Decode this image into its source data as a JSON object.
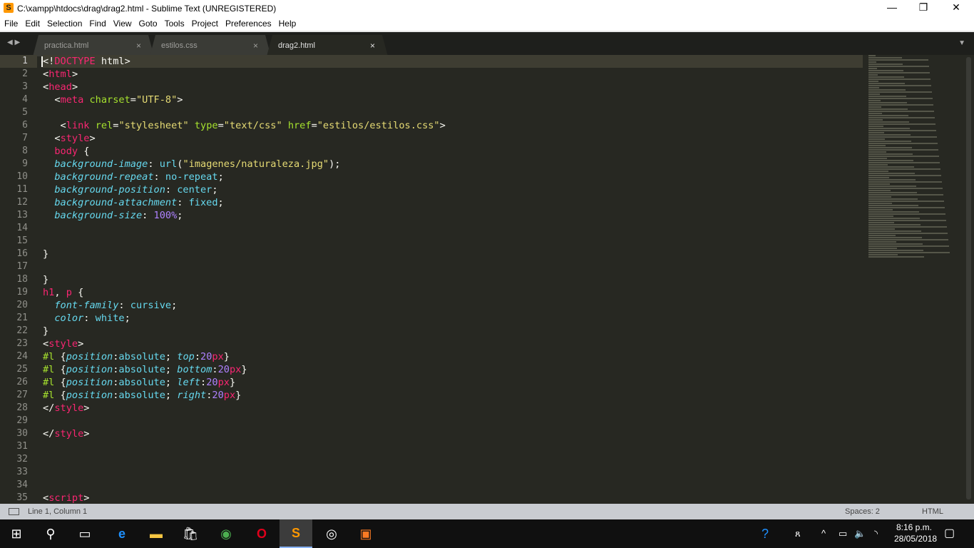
{
  "window": {
    "title": "C:\\xampp\\htdocs\\drag\\drag2.html - Sublime Text (UNREGISTERED)",
    "minimize": "—",
    "maximize": "❐",
    "close": "✕"
  },
  "menu": [
    "File",
    "Edit",
    "Selection",
    "Find",
    "View",
    "Goto",
    "Tools",
    "Project",
    "Preferences",
    "Help"
  ],
  "tabs": [
    {
      "label": "practica.html",
      "close": "×"
    },
    {
      "label": "estilos.css",
      "close": "×"
    },
    {
      "label": "drag2.html",
      "close": "×",
      "active": true
    }
  ],
  "editor": {
    "current_line": 1,
    "lines": [
      [
        [
          "<!",
          ""
        ],
        [
          "DOCTYPE",
          "k-tag"
        ],
        [
          " html>",
          ""
        ]
      ],
      [
        [
          "<",
          ""
        ],
        [
          "html",
          "k-tag"
        ],
        [
          ">",
          ""
        ]
      ],
      [
        [
          "<",
          ""
        ],
        [
          "head",
          "k-tag"
        ],
        [
          ">",
          ""
        ]
      ],
      [
        [
          "  <",
          ""
        ],
        [
          "meta",
          "k-tag"
        ],
        [
          " ",
          ""
        ],
        [
          "charset",
          "k-attr"
        ],
        [
          "=",
          ""
        ],
        [
          "\"UTF-8\"",
          "k-str"
        ],
        [
          ">",
          ""
        ]
      ],
      [
        [
          "",
          ""
        ]
      ],
      [
        [
          "   <",
          ""
        ],
        [
          "link",
          "k-tag"
        ],
        [
          " ",
          ""
        ],
        [
          "rel",
          "k-attr"
        ],
        [
          "=",
          ""
        ],
        [
          "\"stylesheet\"",
          "k-str"
        ],
        [
          " ",
          ""
        ],
        [
          "type",
          "k-attr"
        ],
        [
          "=",
          ""
        ],
        [
          "\"text/css\"",
          "k-str"
        ],
        [
          " ",
          ""
        ],
        [
          "href",
          "k-attr"
        ],
        [
          "=",
          ""
        ],
        [
          "\"estilos/estilos.css\"",
          "k-str"
        ],
        [
          ">",
          ""
        ]
      ],
      [
        [
          "  <",
          ""
        ],
        [
          "style",
          "k-tag"
        ],
        [
          ">",
          ""
        ]
      ],
      [
        [
          "  ",
          ""
        ],
        [
          "body",
          "k-tag"
        ],
        [
          " {",
          ""
        ]
      ],
      [
        [
          "  ",
          ""
        ],
        [
          "background-image",
          "k-prop"
        ],
        [
          ": ",
          ""
        ],
        [
          "url",
          "k-val"
        ],
        [
          "(",
          ""
        ],
        [
          "\"imagenes/naturaleza.jpg\"",
          "k-str"
        ],
        [
          ");",
          ""
        ]
      ],
      [
        [
          "  ",
          ""
        ],
        [
          "background-repeat",
          "k-prop"
        ],
        [
          ": ",
          ""
        ],
        [
          "no-repeat",
          "k-val"
        ],
        [
          ";",
          ""
        ]
      ],
      [
        [
          "  ",
          ""
        ],
        [
          "background-position",
          "k-prop"
        ],
        [
          ": ",
          ""
        ],
        [
          "center",
          "k-val"
        ],
        [
          ";",
          ""
        ]
      ],
      [
        [
          "  ",
          ""
        ],
        [
          "background-attachment",
          "k-prop"
        ],
        [
          ": ",
          ""
        ],
        [
          "fixed",
          "k-val"
        ],
        [
          ";",
          ""
        ]
      ],
      [
        [
          "  ",
          ""
        ],
        [
          "background-size",
          "k-prop"
        ],
        [
          ": ",
          ""
        ],
        [
          "100",
          "k-num"
        ],
        [
          "%",
          "k-num"
        ],
        [
          ";",
          ""
        ]
      ],
      [
        [
          "",
          ""
        ]
      ],
      [
        [
          "",
          ""
        ]
      ],
      [
        [
          "}",
          ""
        ]
      ],
      [
        [
          "",
          ""
        ]
      ],
      [
        [
          "}",
          ""
        ]
      ],
      [
        [
          "h1",
          "k-tag"
        ],
        [
          ", ",
          ""
        ],
        [
          "p",
          "k-tag"
        ],
        [
          " {",
          ""
        ]
      ],
      [
        [
          "  ",
          ""
        ],
        [
          "font-family",
          "k-prop"
        ],
        [
          ": ",
          ""
        ],
        [
          "cursive",
          "k-val"
        ],
        [
          ";",
          ""
        ]
      ],
      [
        [
          "  ",
          ""
        ],
        [
          "color",
          "k-prop"
        ],
        [
          ": ",
          ""
        ],
        [
          "white",
          "k-val"
        ],
        [
          ";",
          ""
        ]
      ],
      [
        [
          "}",
          ""
        ]
      ],
      [
        [
          "<",
          ""
        ],
        [
          "style",
          "k-tag"
        ],
        [
          ">",
          ""
        ]
      ],
      [
        [
          "#l",
          "k-sel"
        ],
        [
          " {",
          ""
        ],
        [
          "position",
          "k-prop"
        ],
        [
          ":",
          ""
        ],
        [
          "absolute",
          "k-val"
        ],
        [
          "; ",
          ""
        ],
        [
          "top",
          "k-prop"
        ],
        [
          ":",
          ""
        ],
        [
          "20",
          "k-num"
        ],
        [
          "px",
          "k-unit"
        ],
        [
          "}",
          ""
        ]
      ],
      [
        [
          "#l",
          "k-sel"
        ],
        [
          " {",
          ""
        ],
        [
          "position",
          "k-prop"
        ],
        [
          ":",
          ""
        ],
        [
          "absolute",
          "k-val"
        ],
        [
          "; ",
          ""
        ],
        [
          "bottom",
          "k-prop"
        ],
        [
          ":",
          ""
        ],
        [
          "20",
          "k-num"
        ],
        [
          "px",
          "k-unit"
        ],
        [
          "}",
          ""
        ]
      ],
      [
        [
          "#l",
          "k-sel"
        ],
        [
          " {",
          ""
        ],
        [
          "position",
          "k-prop"
        ],
        [
          ":",
          ""
        ],
        [
          "absolute",
          "k-val"
        ],
        [
          "; ",
          ""
        ],
        [
          "left",
          "k-prop"
        ],
        [
          ":",
          ""
        ],
        [
          "20",
          "k-num"
        ],
        [
          "px",
          "k-unit"
        ],
        [
          "}",
          ""
        ]
      ],
      [
        [
          "#l",
          "k-sel"
        ],
        [
          " {",
          ""
        ],
        [
          "position",
          "k-prop"
        ],
        [
          ":",
          ""
        ],
        [
          "absolute",
          "k-val"
        ],
        [
          "; ",
          ""
        ],
        [
          "right",
          "k-prop"
        ],
        [
          ":",
          ""
        ],
        [
          "20",
          "k-num"
        ],
        [
          "px",
          "k-unit"
        ],
        [
          "}",
          ""
        ]
      ],
      [
        [
          "</",
          ""
        ],
        [
          "style",
          "k-tag"
        ],
        [
          ">",
          ""
        ]
      ],
      [
        [
          "",
          ""
        ]
      ],
      [
        [
          "</",
          ""
        ],
        [
          "style",
          "k-tag"
        ],
        [
          ">",
          ""
        ]
      ],
      [
        [
          "",
          ""
        ]
      ],
      [
        [
          "",
          ""
        ]
      ],
      [
        [
          "",
          ""
        ]
      ],
      [
        [
          "",
          ""
        ]
      ],
      [
        [
          "<",
          ""
        ],
        [
          "script",
          "k-tag"
        ],
        [
          ">",
          ""
        ]
      ]
    ]
  },
  "status": {
    "position": "Line 1, Column 1",
    "indent": "Spaces: 2",
    "syntax": "HTML"
  },
  "taskbar": {
    "apps": [
      "start",
      "search",
      "task-view",
      "edge",
      "file-explorer",
      "store",
      "chrome",
      "opera",
      "sublime-text",
      "media-app",
      "xampp"
    ],
    "time": "8:16 p.m.",
    "date": "28/05/2018"
  }
}
